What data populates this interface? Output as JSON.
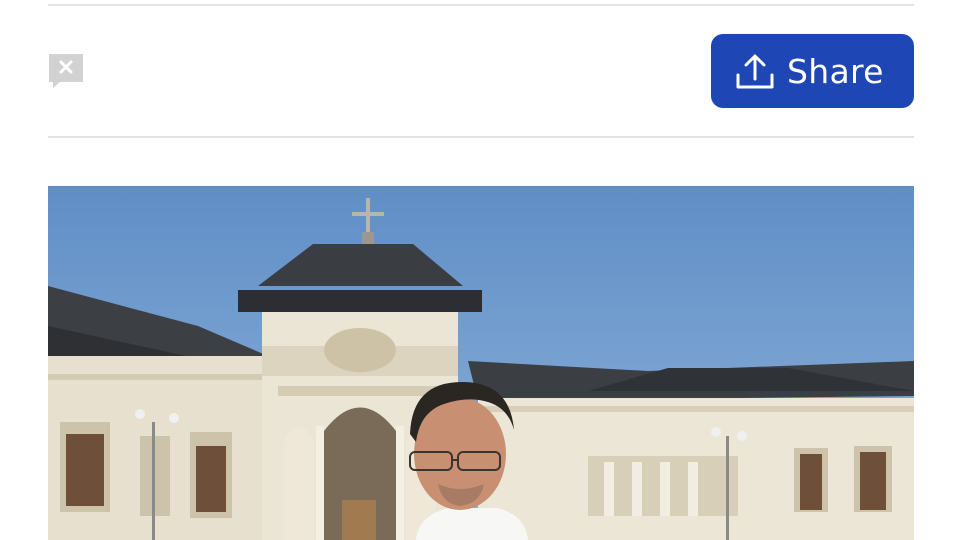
{
  "toolbar": {
    "share_label": "Share",
    "share_icon": "upload-share-icon",
    "accent": "#1e46b5",
    "broken_image_icon": "broken-image-icon"
  },
  "article": {
    "image_icon": "article-photo"
  }
}
